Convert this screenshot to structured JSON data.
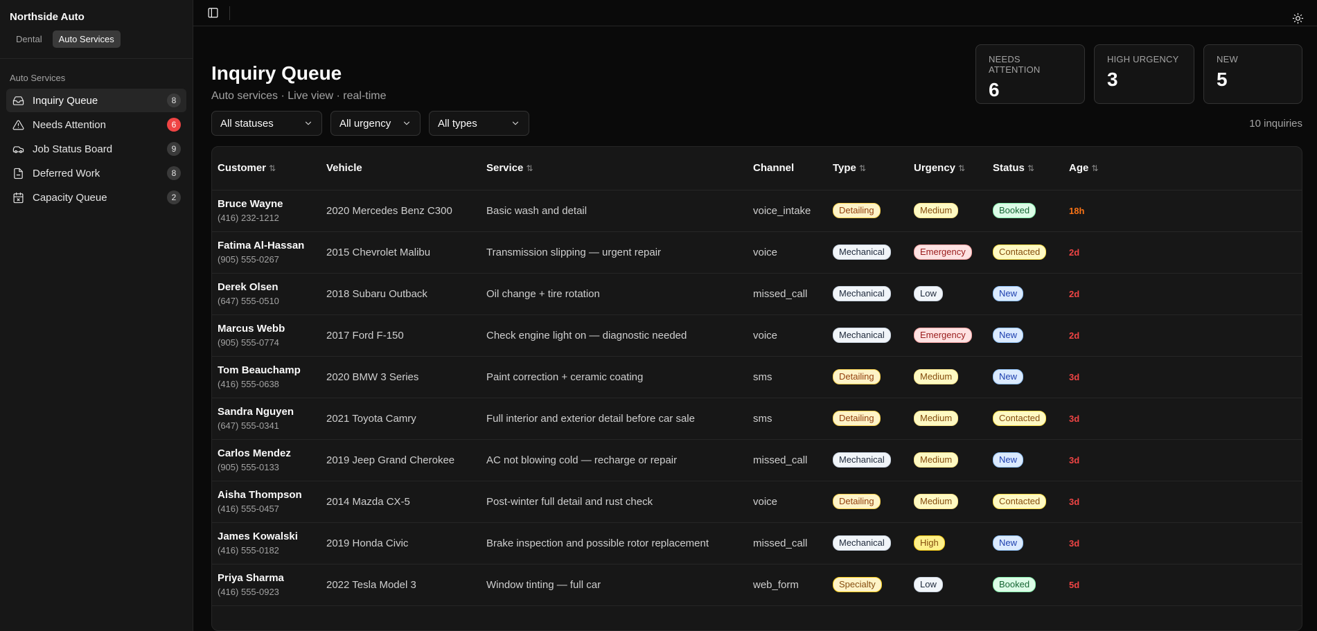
{
  "sidebar": {
    "brand": "Northside Auto",
    "verticals": [
      {
        "label": "Dental",
        "active": false
      },
      {
        "label": "Auto Services",
        "active": true
      }
    ],
    "group_label": "Auto Services",
    "items": [
      {
        "label": "Inquiry Queue",
        "count": "8",
        "icon": "inbox-icon",
        "active": true
      },
      {
        "label": "Needs Attention",
        "count": "6",
        "icon": "warning-icon",
        "active": false
      },
      {
        "label": "Job Status Board",
        "count": "9",
        "icon": "car-icon",
        "active": false
      },
      {
        "label": "Deferred Work",
        "count": "8",
        "icon": "file-icon",
        "active": false
      },
      {
        "label": "Capacity Queue",
        "count": "2",
        "icon": "calendar-icon",
        "active": false
      }
    ]
  },
  "topbar": {
    "toggle_icon": "sidebar-toggle-icon",
    "theme_icon": "sun-icon"
  },
  "header": {
    "title": "Inquiry Queue",
    "subtitle": "Auto services · Live view · real-time"
  },
  "stats": [
    {
      "label": "Needs Attention",
      "value": "6"
    },
    {
      "label": "High Urgency",
      "value": "3"
    },
    {
      "label": "New",
      "value": "5"
    }
  ],
  "filters": {
    "status": "All statuses",
    "urgency": "All urgency",
    "type": "All types",
    "count_text": "10 inquiries"
  },
  "table": {
    "columns": [
      {
        "label": "Customer",
        "sortable": true
      },
      {
        "label": "Vehicle",
        "sortable": false
      },
      {
        "label": "Service",
        "sortable": true
      },
      {
        "label": "Channel",
        "sortable": false
      },
      {
        "label": "Type",
        "sortable": true
      },
      {
        "label": "Urgency",
        "sortable": true
      },
      {
        "label": "Status",
        "sortable": true
      },
      {
        "label": "Age",
        "sortable": true
      }
    ],
    "rows": [
      {
        "name": "Bruce Wayne",
        "phone": "(416) 232-1212",
        "vehicle": "2020 Mercedes Benz C300",
        "service": "Basic wash and detail",
        "channel": "voice_intake",
        "type": "Detailing",
        "urgency": "Medium",
        "status": "Booked",
        "age": "18h"
      },
      {
        "name": "Fatima Al-Hassan",
        "phone": "(905) 555-0267",
        "vehicle": "2015 Chevrolet Malibu",
        "service": "Transmission slipping — urgent repair",
        "channel": "voice",
        "type": "Mechanical",
        "urgency": "Emergency",
        "status": "Contacted",
        "age": "2d"
      },
      {
        "name": "Derek Olsen",
        "phone": "(647) 555-0510",
        "vehicle": "2018 Subaru Outback",
        "service": "Oil change + tire rotation",
        "channel": "missed_call",
        "type": "Mechanical",
        "urgency": "Low",
        "status": "New",
        "age": "2d"
      },
      {
        "name": "Marcus Webb",
        "phone": "(905) 555-0774",
        "vehicle": "2017 Ford F-150",
        "service": "Check engine light on — diagnostic needed",
        "channel": "voice",
        "type": "Mechanical",
        "urgency": "Emergency",
        "status": "New",
        "age": "2d"
      },
      {
        "name": "Tom Beauchamp",
        "phone": "(416) 555-0638",
        "vehicle": "2020 BMW 3 Series",
        "service": "Paint correction + ceramic coating",
        "channel": "sms",
        "type": "Detailing",
        "urgency": "Medium",
        "status": "New",
        "age": "3d"
      },
      {
        "name": "Sandra Nguyen",
        "phone": "(647) 555-0341",
        "vehicle": "2021 Toyota Camry",
        "service": "Full interior and exterior detail before car sale",
        "channel": "sms",
        "type": "Detailing",
        "urgency": "Medium",
        "status": "Contacted",
        "age": "3d"
      },
      {
        "name": "Carlos Mendez",
        "phone": "(905) 555-0133",
        "vehicle": "2019 Jeep Grand Cherokee",
        "service": "AC not blowing cold — recharge or repair",
        "channel": "missed_call",
        "type": "Mechanical",
        "urgency": "Medium",
        "status": "New",
        "age": "3d"
      },
      {
        "name": "Aisha Thompson",
        "phone": "(416) 555-0457",
        "vehicle": "2014 Mazda CX-5",
        "service": "Post-winter full detail and rust check",
        "channel": "voice",
        "type": "Detailing",
        "urgency": "Medium",
        "status": "Contacted",
        "age": "3d"
      },
      {
        "name": "James Kowalski",
        "phone": "(416) 555-0182",
        "vehicle": "2019 Honda Civic",
        "service": "Brake inspection and possible rotor replacement",
        "channel": "missed_call",
        "type": "Mechanical",
        "urgency": "High",
        "status": "New",
        "age": "3d"
      },
      {
        "name": "Priya Sharma",
        "phone": "(416) 555-0923",
        "vehicle": "2022 Tesla Model 3",
        "service": "Window tinting — full car",
        "channel": "web_form",
        "type": "Specialty",
        "urgency": "Low",
        "status": "Booked",
        "age": "5d"
      }
    ]
  },
  "colors": {
    "background": "#0a0a0a",
    "sidebar": "#171717",
    "danger": "#ef4444",
    "age_recent": "#f97316"
  }
}
